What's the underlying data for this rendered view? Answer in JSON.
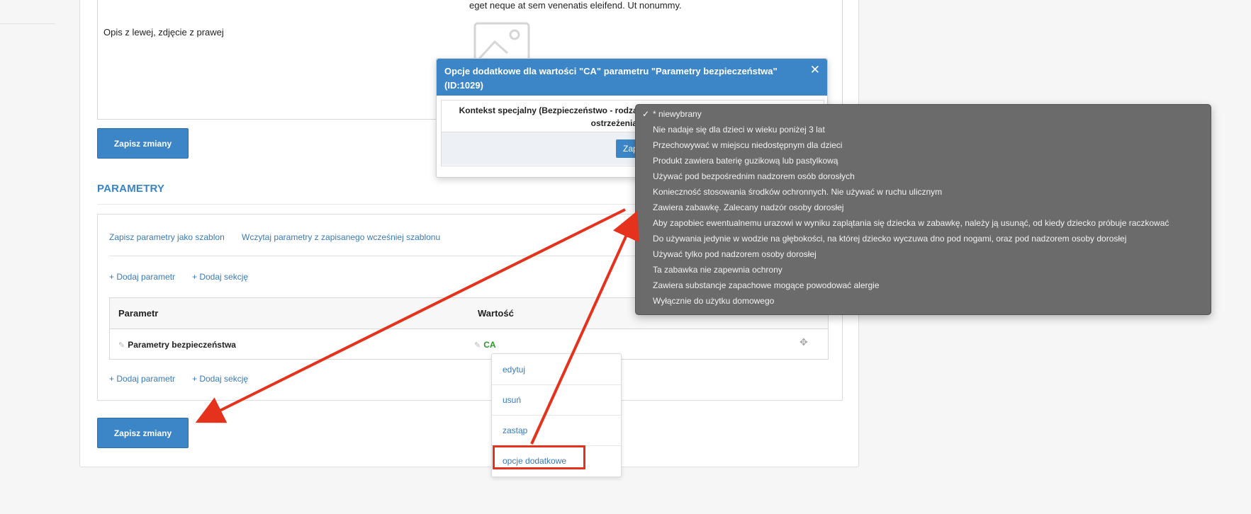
{
  "editor": {
    "top_text": "eget neque at sem venenatis eleifend. Ut nonummy.",
    "left_text": "Opis z lewej, zdjęcie z prawej"
  },
  "buttons": {
    "save_top": "Zapisz zmiany",
    "save_bottom": "Zapisz zmiany"
  },
  "parameters": {
    "section_title": "PARAMETRY",
    "save_template": "Zapisz parametry jako szablon",
    "load_template": "Wczytaj parametry z zapisanego wcześniej szablonu",
    "add_param": "+ Dodaj parametr",
    "add_section": "+ Dodaj sekcję",
    "table": {
      "headers": [
        "Parametr",
        "Wartość"
      ],
      "rows": [
        {
          "param": "Parametry bezpieczeństwa",
          "value": "CA"
        }
      ]
    }
  },
  "context_menu": {
    "items": [
      "edytuj",
      "usuń",
      "zastąp",
      "opcje dodatkowe"
    ]
  },
  "modal": {
    "title": "Opcje dodatkowe dla wartości \"CA\" parametru \"Parametry bezpieczeństwa\" (ID:1029)",
    "close_icon": "✕",
    "field_label": "Kontekst specjalny (Bezpieczeństwo - rodzaj ostrzeżenia)",
    "save_label": "Zapi"
  },
  "dropdown": {
    "selected": "* niewybrany",
    "options": [
      "* niewybrany",
      "Nie nadaje się dla dzieci w wieku poniżej 3 lat",
      "Przechowywać w miejscu niedostępnym dla dzieci",
      "Produkt zawiera baterię guzikową lub pastylkową",
      "Używać pod bezpośrednim nadzorem osób dorosłych",
      "Konieczność stosowania środków ochronnych. Nie używać w ruchu ulicznym",
      "Zawiera zabawkę. Zalecany nadzór osoby dorosłej",
      "Aby zapobiec ewentualnemu urazowi w wyniku zaplątania się dziecka w zabawkę, należy ją usunąć, od kiedy dziecko próbuje raczkować",
      "Do używania jedynie w wodzie na głębokości, na której dziecko wyczuwa dno pod nogami, oraz pod nadzorem osoby dorosłej",
      "Używać tylko pod nadzorem osoby dorosłej",
      "Ta zabawka nie zapewnia ochrony",
      "Zawiera substancje zapachowe mogące powodować alergie",
      "Wyłącznie do użytku domowego"
    ]
  },
  "colors": {
    "accent": "#3c86c8",
    "annotation": "#e4321c",
    "value_green": "#2a9a2a"
  }
}
